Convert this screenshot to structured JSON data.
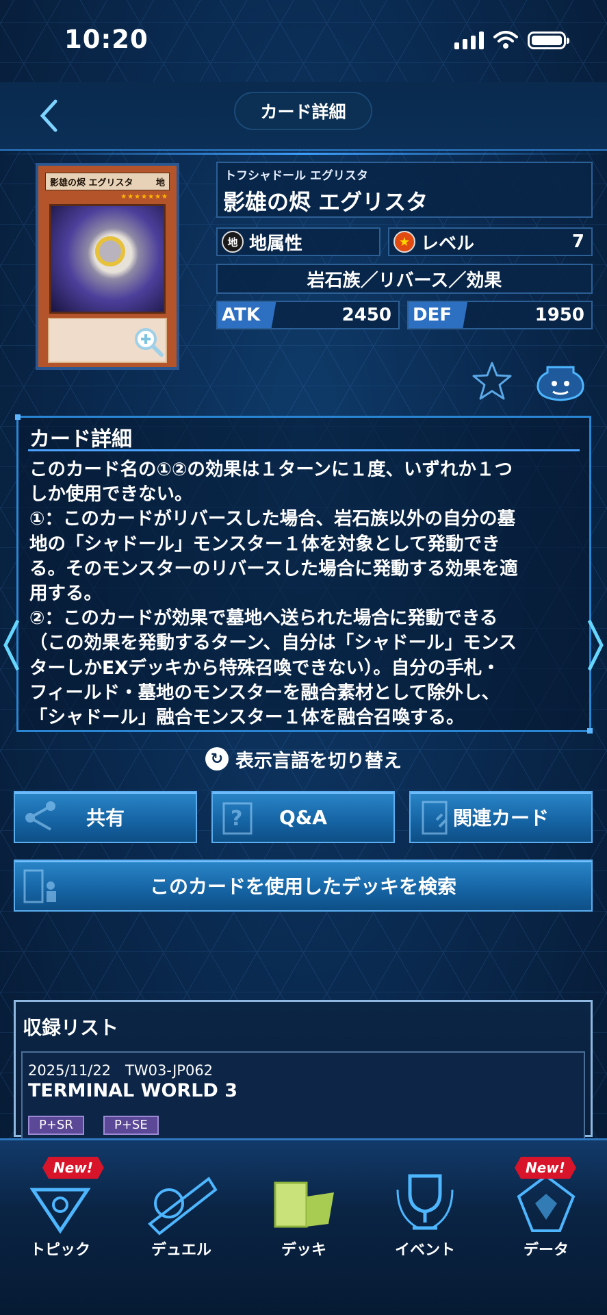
{
  "status": {
    "time": "10:20"
  },
  "header": {
    "title": "カード詳細"
  },
  "card": {
    "image_name": "影雄の烬 エグリスタ",
    "image_attribute": "地",
    "furigana": "トフシャドール エグリスタ",
    "name": "影雄の烬 エグリスタ",
    "attribute_icon": "地",
    "attribute": "地属性",
    "level_label": "レベル",
    "level": "7",
    "type": "岩石族／リバース／効果",
    "atk_label": "ATK",
    "atk": "2450",
    "def_label": "DEF",
    "def": "1950"
  },
  "details": {
    "title": "カード詳細",
    "text": "このカード名の①②の効果は１ターンに１度、いずれか１つ\nしか使用できない。\n①：このカードがリバースした場合、岩石族以外の自分の墓\n地の「シャドール」モンスター１体を対象として発動でき\nる。そのモンスターのリバースした場合に発動する効果を適\n用する。\n②：このカードが効果で墓地へ送られた場合に発動できる\n（この効果を発動するターン、自分は「シャドール」モンス\nターしかEXデッキから特殊召喚できない）。自分の手札・\nフィールド・墓地のモンスターを融合素材として除外し、\n「シャドール」融合モンスター１体を融合召喚する。"
  },
  "lang_toggle": "表示言語を切り替え",
  "actions": {
    "share": "共有",
    "qa": "Q&A",
    "related": "関連カード",
    "deck_search": "このカードを使用したデッキを検索"
  },
  "records": {
    "title": "収録リスト",
    "items": [
      {
        "date": "2025/11/22　TW03-JP062",
        "name": "TERMINAL WORLD 3",
        "rarities": [
          "P+SR",
          "P+SE"
        ]
      }
    ]
  },
  "nav": {
    "new_badge": "New!",
    "items": [
      "トピック",
      "デュエル",
      "デッキ",
      "イベント",
      "データ"
    ]
  },
  "colors": {
    "accent": "#2a86c8",
    "background": "#0a2a50",
    "new_badge": "#d8142a"
  }
}
